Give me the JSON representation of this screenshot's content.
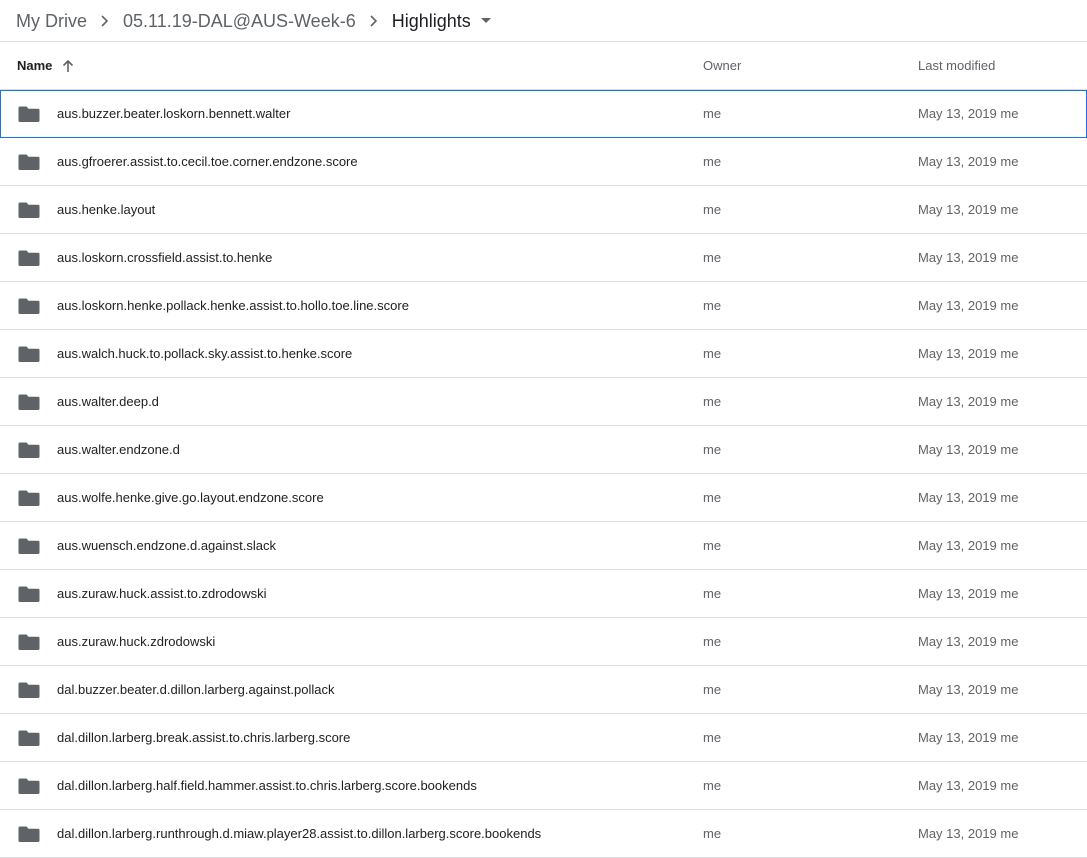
{
  "breadcrumb": {
    "items": [
      {
        "label": "My Drive"
      },
      {
        "label": "05.11.19-DAL@AUS-Week-6"
      },
      {
        "label": "Highlights"
      }
    ]
  },
  "table": {
    "columns": {
      "name": "Name",
      "owner": "Owner",
      "modified": "Last modified"
    },
    "sort": {
      "column": "name",
      "direction": "ascending"
    },
    "rows": [
      {
        "name": "aus.buzzer.beater.loskorn.bennett.walter",
        "owner": "me",
        "modified": "May 13, 2019 me",
        "selected": true
      },
      {
        "name": "aus.gfroerer.assist.to.cecil.toe.corner.endzone.score",
        "owner": "me",
        "modified": "May 13, 2019 me"
      },
      {
        "name": "aus.henke.layout",
        "owner": "me",
        "modified": "May 13, 2019 me"
      },
      {
        "name": "aus.loskorn.crossfield.assist.to.henke",
        "owner": "me",
        "modified": "May 13, 2019 me"
      },
      {
        "name": "aus.loskorn.henke.pollack.henke.assist.to.hollo.toe.line.score",
        "owner": "me",
        "modified": "May 13, 2019 me"
      },
      {
        "name": "aus.walch.huck.to.pollack.sky.assist.to.henke.score",
        "owner": "me",
        "modified": "May 13, 2019 me"
      },
      {
        "name": "aus.walter.deep.d",
        "owner": "me",
        "modified": "May 13, 2019 me"
      },
      {
        "name": "aus.walter.endzone.d",
        "owner": "me",
        "modified": "May 13, 2019 me"
      },
      {
        "name": "aus.wolfe.henke.give.go.layout.endzone.score",
        "owner": "me",
        "modified": "May 13, 2019 me"
      },
      {
        "name": "aus.wuensch.endzone.d.against.slack",
        "owner": "me",
        "modified": "May 13, 2019 me"
      },
      {
        "name": "aus.zuraw.huck.assist.to.zdrodowski",
        "owner": "me",
        "modified": "May 13, 2019 me"
      },
      {
        "name": "aus.zuraw.huck.zdrodowski",
        "owner": "me",
        "modified": "May 13, 2019 me"
      },
      {
        "name": "dal.buzzer.beater.d.dillon.larberg.against.pollack",
        "owner": "me",
        "modified": "May 13, 2019 me"
      },
      {
        "name": "dal.dillon.larberg.break.assist.to.chris.larberg.score",
        "owner": "me",
        "modified": "May 13, 2019 me"
      },
      {
        "name": "dal.dillon.larberg.half.field.hammer.assist.to.chris.larberg.score.bookends",
        "owner": "me",
        "modified": "May 13, 2019 me"
      },
      {
        "name": "dal.dillon.larberg.runthrough.d.miaw.player28.assist.to.dillon.larberg.score.bookends",
        "owner": "me",
        "modified": "May 13, 2019 me"
      }
    ]
  },
  "icons": {
    "row_icon": "folder-icon",
    "crumb_separator": "chevron-right-icon",
    "crumb_dropdown": "caret-down-icon",
    "sort": "arrow-up-icon"
  },
  "colors": {
    "folder": "#5f6368",
    "selection_outline": "#1a73e8",
    "divider": "#dadce0"
  }
}
